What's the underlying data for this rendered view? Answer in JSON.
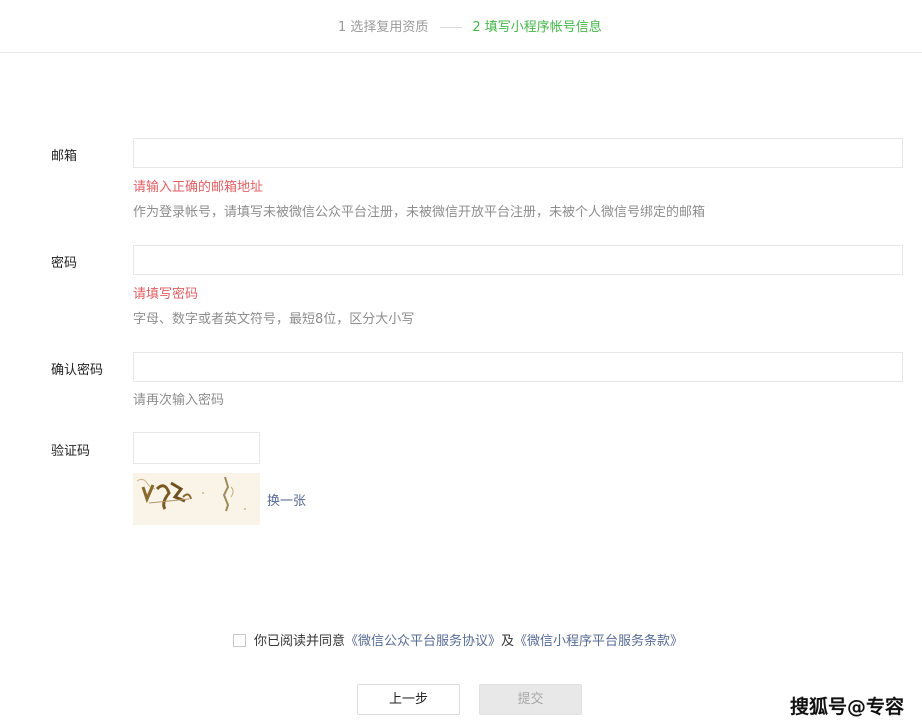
{
  "steps": {
    "step1": "1 选择复用资质",
    "step2": "2 填写小程序帐号信息"
  },
  "form": {
    "email": {
      "label": "邮箱",
      "value": "",
      "error": "请输入正确的邮箱地址",
      "tip": "作为登录帐号，请填写未被微信公众平台注册，未被微信开放平台注册，未被个人微信号绑定的邮箱"
    },
    "password": {
      "label": "密码",
      "value": "",
      "error": "请填写密码",
      "tip": "字母、数字或者英文符号，最短8位，区分大小写"
    },
    "confirm": {
      "label": "确认密码",
      "value": "",
      "tip": "请再次输入密码"
    },
    "captcha": {
      "label": "验证码",
      "value": "",
      "change_label": "换一张"
    }
  },
  "agreement": {
    "prefix": "你已阅读并同意",
    "link1": "《微信公众平台服务协议》",
    "joiner": "及",
    "link2": "《微信小程序平台服务条款》"
  },
  "buttons": {
    "prev": "上一步",
    "submit": "提交"
  },
  "watermark": "搜狐号@专容",
  "colors": {
    "accent": "#44b549",
    "error": "#e15f63",
    "link": "#576b95"
  }
}
